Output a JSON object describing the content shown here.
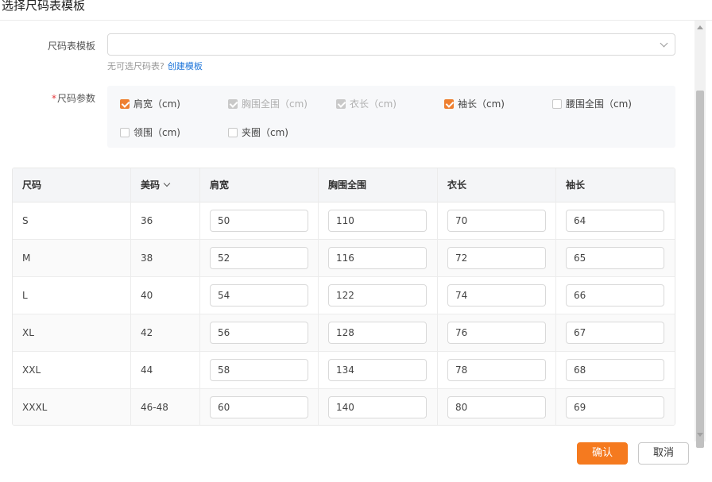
{
  "dialog": {
    "title": "选择尺码表模板"
  },
  "template_field": {
    "label": "尺码表模板",
    "value": ""
  },
  "hint": {
    "text": "无可选尺码表?",
    "link": "创建模板"
  },
  "params": {
    "label": "尺码参数",
    "required_mark": "*",
    "options": [
      {
        "label": "肩宽（cm)",
        "state": "checked"
      },
      {
        "label": "胸围全围（cm)",
        "state": "disabled"
      },
      {
        "label": "衣长（cm)",
        "state": "disabled"
      },
      {
        "label": "袖长（cm)",
        "state": "checked"
      },
      {
        "label": "腰围全围（cm)",
        "state": "unchecked"
      },
      {
        "label": "领围（cm)",
        "state": "unchecked"
      },
      {
        "label": "夹圈（cm)",
        "state": "unchecked"
      }
    ]
  },
  "table": {
    "headers": [
      "尺码",
      "美码",
      "肩宽",
      "胸围全围",
      "衣长",
      "袖长"
    ],
    "rows": [
      {
        "size": "S",
        "us": "36",
        "shoulder": "50",
        "chest": "110",
        "length": "70",
        "sleeve": "64"
      },
      {
        "size": "M",
        "us": "38",
        "shoulder": "52",
        "chest": "116",
        "length": "72",
        "sleeve": "65"
      },
      {
        "size": "L",
        "us": "40",
        "shoulder": "54",
        "chest": "122",
        "length": "74",
        "sleeve": "66"
      },
      {
        "size": "XL",
        "us": "42",
        "shoulder": "56",
        "chest": "128",
        "length": "76",
        "sleeve": "67"
      },
      {
        "size": "XXL",
        "us": "44",
        "shoulder": "58",
        "chest": "134",
        "length": "78",
        "sleeve": "68"
      },
      {
        "size": "XXXL",
        "us": "46-48",
        "shoulder": "60",
        "chest": "140",
        "length": "80",
        "sleeve": "69"
      }
    ]
  },
  "footer": {
    "confirm": "确认",
    "cancel": "取消"
  },
  "colors": {
    "accent": "#f57a1f",
    "link": "#1a73d9",
    "required": "#e4393c"
  }
}
